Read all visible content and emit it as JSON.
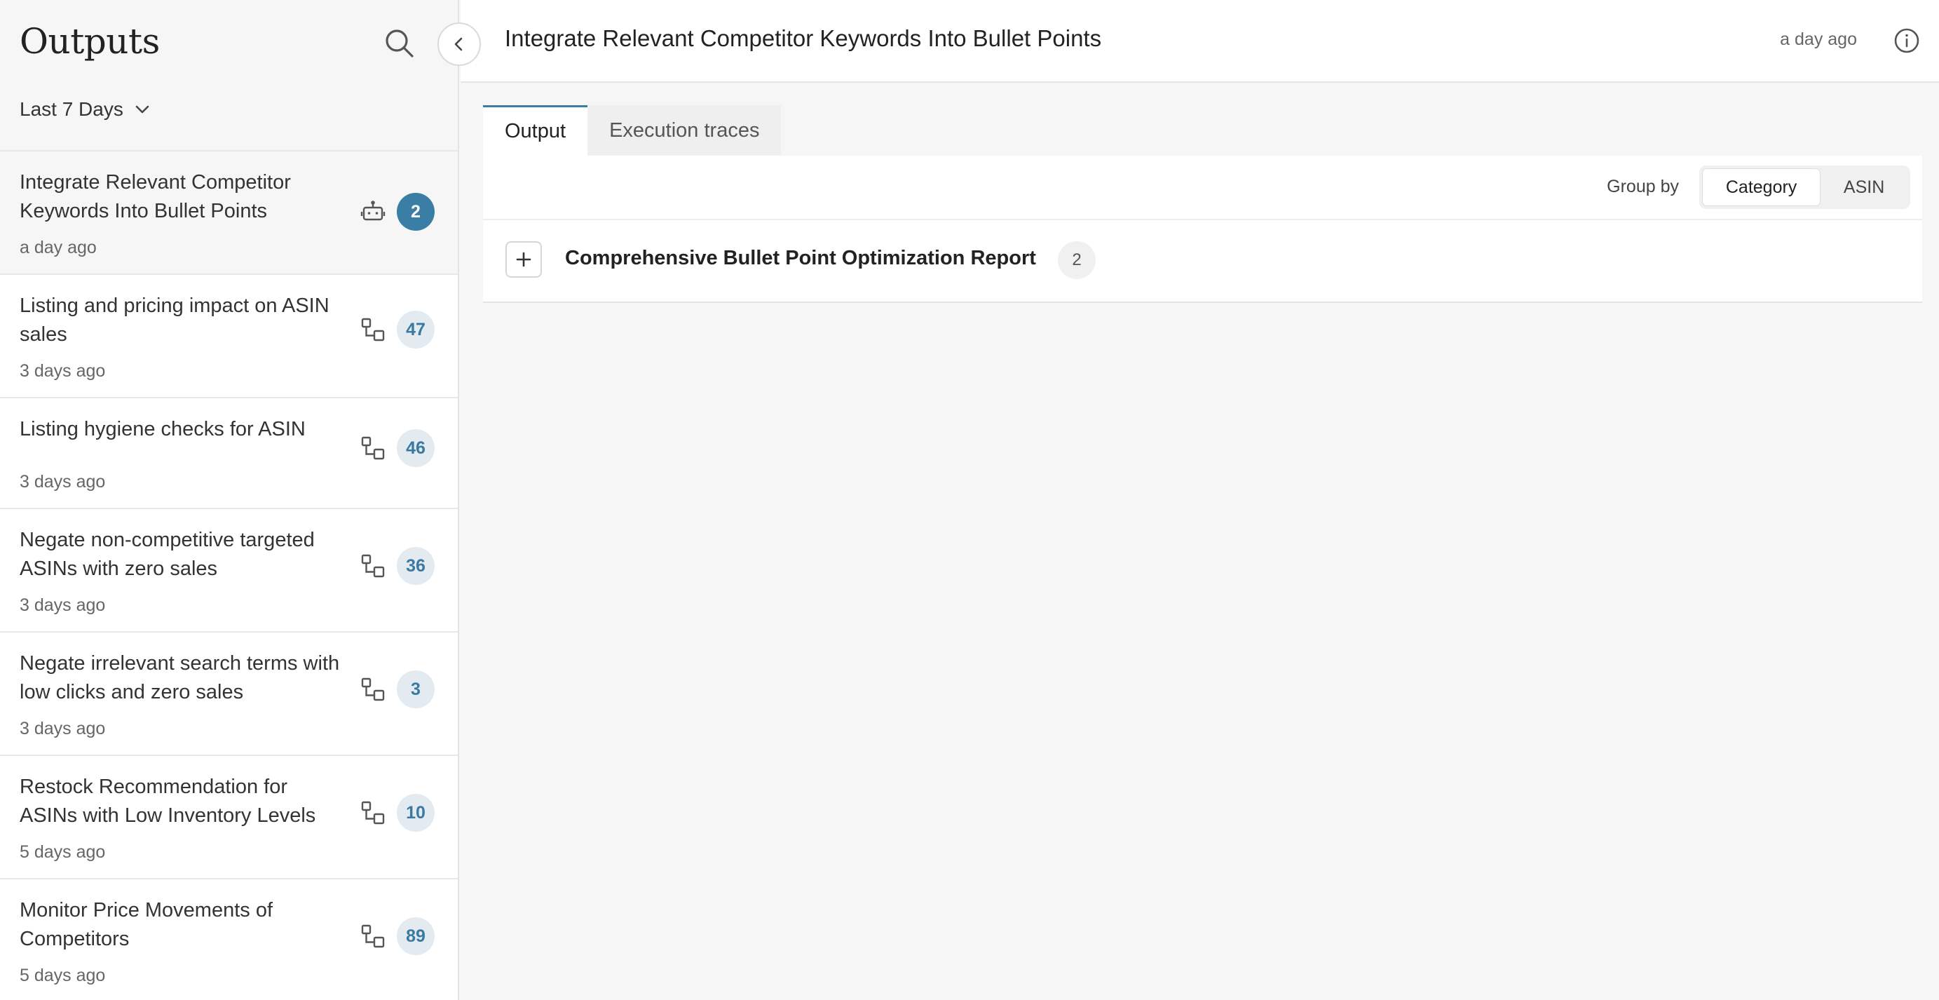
{
  "sidebar": {
    "title": "Outputs",
    "filter": "Last 7 Days",
    "items": [
      {
        "title": "Integrate Relevant Competitor Keywords Into Bullet Points",
        "time": "a day ago",
        "count": "2",
        "icon": "robot-icon"
      },
      {
        "title": "Listing and pricing impact on ASIN sales",
        "time": "3 days ago",
        "count": "47",
        "icon": "workflow-icon"
      },
      {
        "title": "Listing hygiene checks for ASIN",
        "time": "3 days ago",
        "count": "46",
        "icon": "workflow-icon"
      },
      {
        "title": "Negate non-competitive targeted ASINs with zero sales",
        "time": "3 days ago",
        "count": "36",
        "icon": "workflow-icon"
      },
      {
        "title": "Negate irrelevant search terms with low clicks and zero sales",
        "time": "3 days ago",
        "count": "3",
        "icon": "workflow-icon"
      },
      {
        "title": "Restock Recommendation for ASINs with Low Inventory Levels",
        "time": "5 days ago",
        "count": "10",
        "icon": "workflow-icon"
      },
      {
        "title": "Monitor Price Movements of Competitors",
        "time": "5 days ago",
        "count": "89",
        "icon": "workflow-icon"
      }
    ]
  },
  "main": {
    "title": "Integrate Relevant Competitor Keywords Into Bullet Points",
    "time": "a day ago",
    "tabs": [
      {
        "label": "Output"
      },
      {
        "label": "Execution traces"
      }
    ],
    "group_by": {
      "label": "Group by",
      "options": [
        "Category",
        "ASIN"
      ],
      "selected": "Category"
    },
    "groups": [
      {
        "title": "Comprehensive Bullet Point Optimization Report",
        "count": "2"
      }
    ]
  },
  "colors": {
    "accent": "#3a7ea6",
    "badge_bg": "#e3eaf0",
    "badge_text": "#3a7aa0"
  }
}
